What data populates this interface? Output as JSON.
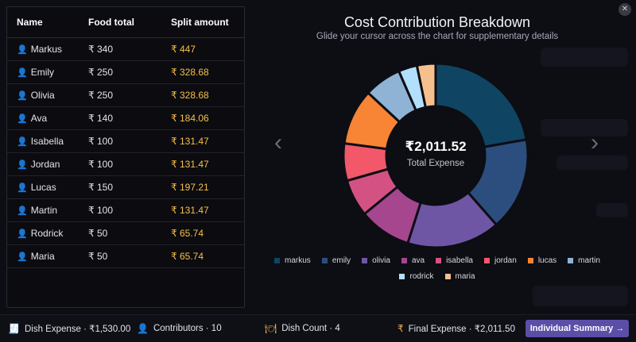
{
  "table": {
    "headers": {
      "name": "Name",
      "food_total": "Food total",
      "split": "Split amount"
    },
    "rows": [
      {
        "name": "Markus",
        "food": "₹ 340",
        "split": "₹ 447"
      },
      {
        "name": "Emily",
        "food": "₹ 250",
        "split": "₹ 328.68"
      },
      {
        "name": "Olivia",
        "food": "₹ 250",
        "split": "₹ 328.68"
      },
      {
        "name": "Ava",
        "food": "₹ 140",
        "split": "₹ 184.06"
      },
      {
        "name": "Isabella",
        "food": "₹ 100",
        "split": "₹ 131.47"
      },
      {
        "name": "Jordan",
        "food": "₹ 100",
        "split": "₹ 131.47"
      },
      {
        "name": "Lucas",
        "food": "₹ 150",
        "split": "₹ 197.21"
      },
      {
        "name": "Martin",
        "food": "₹ 100",
        "split": "₹ 131.47"
      },
      {
        "name": "Rodrick",
        "food": "₹ 50",
        "split": "₹ 65.74"
      },
      {
        "name": "Maria",
        "food": "₹ 50",
        "split": "₹ 65.74"
      }
    ]
  },
  "chart": {
    "title": "Cost Contribution Breakdown",
    "subtitle": "Glide your cursor across the chart for supplementary details",
    "center_amount": "₹2,011.52",
    "center_label": "Total Expense",
    "prev_icon": "chevron-left-icon",
    "next_icon": "chevron-right-icon",
    "close_icon": "close-icon"
  },
  "chart_data": {
    "type": "pie",
    "subtype": "donut",
    "categories": [
      "markus",
      "emily",
      "olivia",
      "ava",
      "isabella",
      "jordan",
      "lucas",
      "martin",
      "rodrick",
      "maria"
    ],
    "values": [
      447,
      328.68,
      328.68,
      184.06,
      131.47,
      131.47,
      197.21,
      131.47,
      65.74,
      65.74
    ],
    "colors": [
      "#0f4563",
      "#2c4e7e",
      "#6f56a5",
      "#a5468f",
      "#d45184",
      "#f2586a",
      "#f88436",
      "#8fb3d4",
      "#b2dffb",
      "#f6c08e"
    ],
    "legend": "bottom"
  },
  "footer": {
    "dish_expense": "Dish Expense · ₹1,530.00",
    "contributors": "Contributors · 10",
    "dish_count": "Dish Count · 4",
    "final_expense": "Final Expense · ₹2,011.50",
    "summary_button": "Individual Summary →"
  }
}
